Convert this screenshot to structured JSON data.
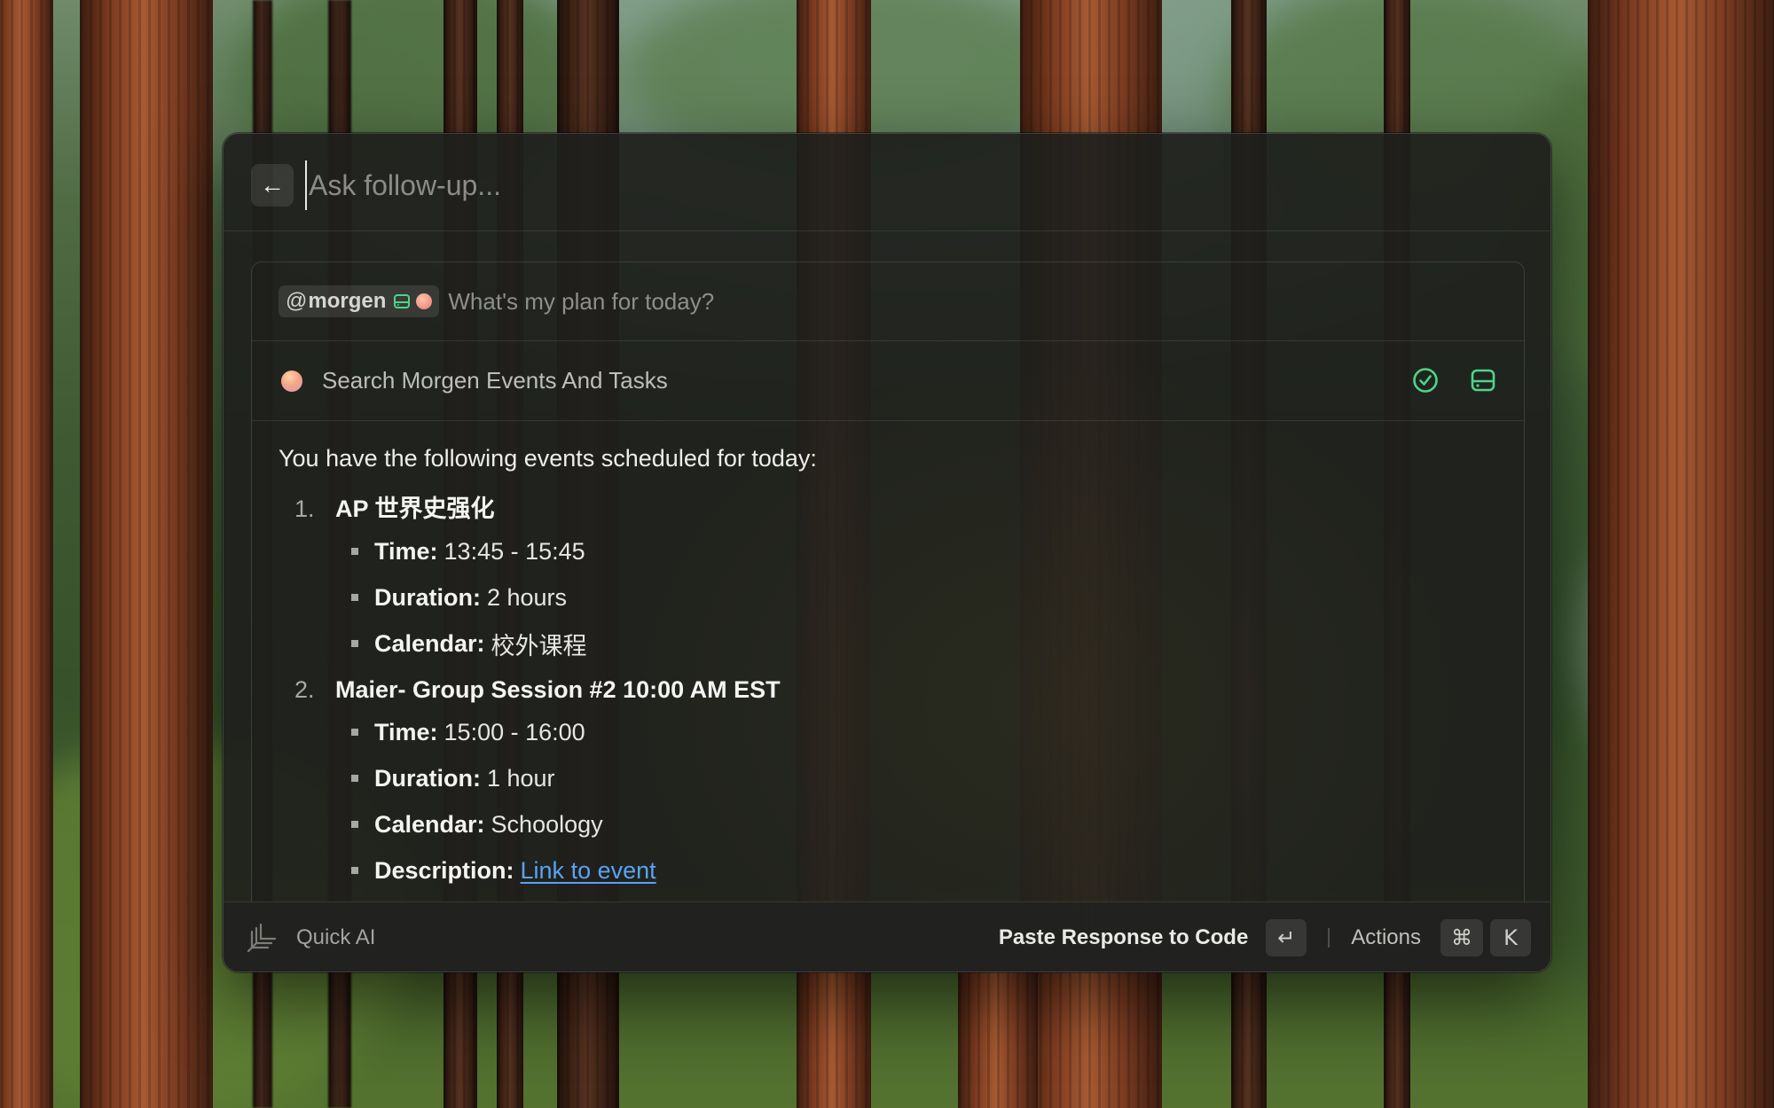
{
  "header": {
    "back_icon": "arrow-left-icon",
    "followup_placeholder": "Ask follow-up..."
  },
  "query": {
    "mention_at": "@",
    "mention_name": "morgen",
    "text": "What's my plan for today?"
  },
  "tool_call": {
    "label": "Search Morgen Events And Tasks",
    "status_icon": "check-circle-icon",
    "extension_icon": "drive-icon",
    "accent_color": "#4fd48a"
  },
  "response": {
    "intro": "You have the following events scheduled for today:",
    "events": [
      {
        "number": "1.",
        "title": "AP 世界史强化",
        "details": [
          {
            "label": "Time:",
            "value": "13:45 - 15:45"
          },
          {
            "label": "Duration:",
            "value": "2 hours"
          },
          {
            "label": "Calendar:",
            "value": "校外课程"
          }
        ]
      },
      {
        "number": "2.",
        "title": "Maier- Group Session #2 10:00 AM EST",
        "details": [
          {
            "label": "Time:",
            "value": "15:00 - 16:00"
          },
          {
            "label": "Duration:",
            "value": "1 hour"
          },
          {
            "label": "Calendar:",
            "value": "Schoology"
          },
          {
            "label": "Description:",
            "value": "Link to event"
          }
        ]
      }
    ],
    "scroll_icon": "arrow-down-icon",
    "link_color": "#5aa2f5"
  },
  "footer": {
    "title": "Quick AI",
    "primary_action": "Paste Response to Code",
    "primary_shortcut": "↵",
    "actions_label": "Actions",
    "actions_shortcut": [
      "⌘",
      "K"
    ]
  }
}
